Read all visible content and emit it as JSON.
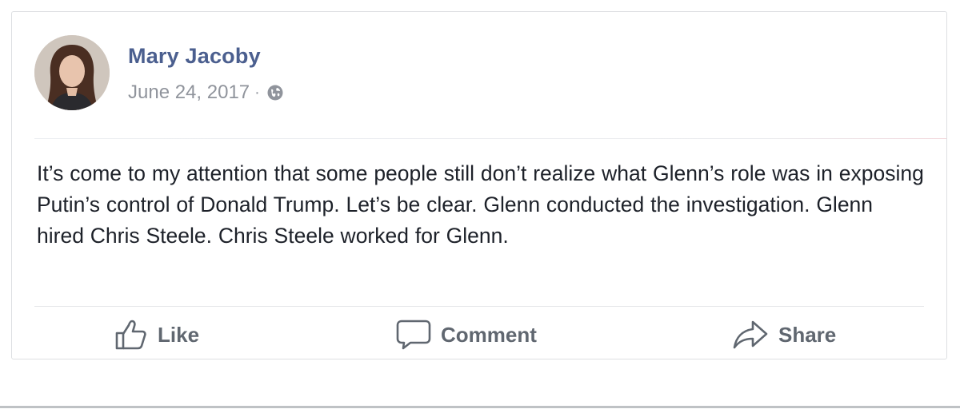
{
  "post": {
    "author_name": "Mary Jacoby",
    "date": "June 24, 2017",
    "separator": "·",
    "audience_icon": "globe-icon",
    "text": "It’s come to my attention that some people still don’t realize what Glenn’s role was in exposing Putin’s control of Donald Trump. Let’s be clear. Glenn conducted the investigation. Glenn hired Chris Steele. Chris Steele worked for Glenn."
  },
  "actions": {
    "like_label": "Like",
    "like_icon": "thumbs-up-icon",
    "comment_label": "Comment",
    "comment_icon": "speech-bubble-icon",
    "share_label": "Share",
    "share_icon": "share-arrow-icon"
  },
  "colors": {
    "author_name": "#4b5f8f",
    "meta_text": "#90949c",
    "body_text": "#1d2129",
    "action_text": "#606770",
    "card_border": "#dddfe2"
  }
}
